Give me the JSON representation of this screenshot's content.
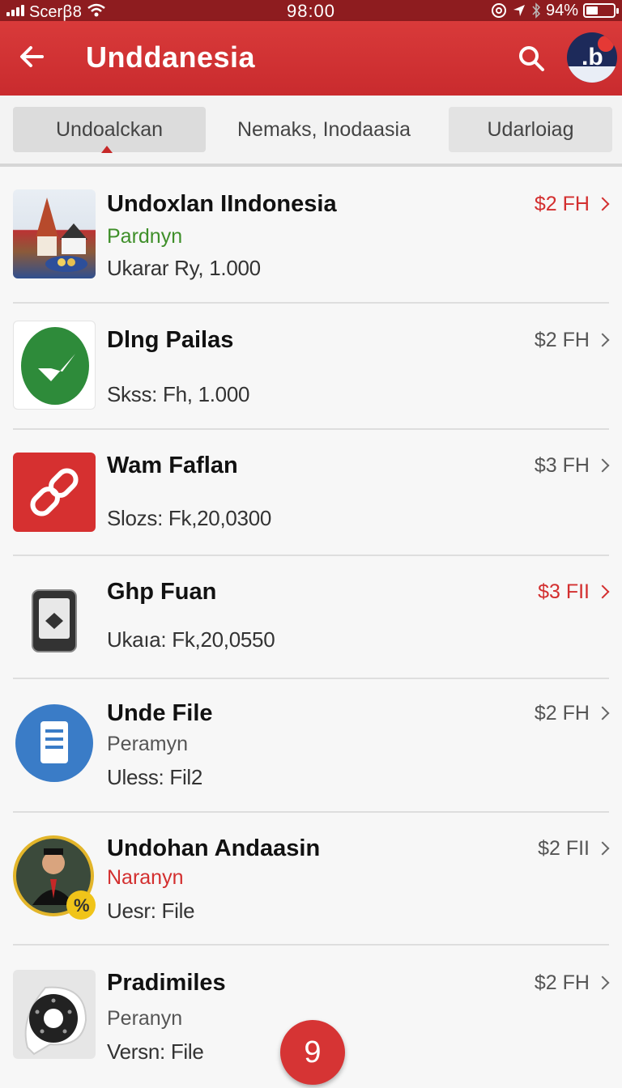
{
  "status_bar": {
    "carrier": "Scerꞵ8",
    "time": "98:00",
    "battery": "94%"
  },
  "app_bar": {
    "title": "Unddanesia",
    "avatar_letter": ".b"
  },
  "tabs": [
    {
      "label": "Undoalckan",
      "active": true
    },
    {
      "label": "Nemaks, Inodaasia",
      "active": false
    },
    {
      "label": "Udarloiag",
      "active": false
    }
  ],
  "items": [
    {
      "title": "Undoxlan IIndonesia",
      "subtitle": "Pardnyn",
      "subtitle_color": "#3f8f2a",
      "meta": "Ukarar Ry, 1.000",
      "price": "$2 FH",
      "price_red": true,
      "icon": "indonesia-landmarks-icon"
    },
    {
      "title": "Dlng Pailas",
      "subtitle": "",
      "subtitle_color": "#555555",
      "meta": "Skss: Fh, 1.000",
      "price": "$2 FH",
      "price_red": false,
      "icon": "green-check-icon"
    },
    {
      "title": "Wam Faflan",
      "subtitle": "",
      "subtitle_color": "#555555",
      "meta": "Slozs: Fk,20,0300",
      "price": "$3 FH",
      "price_red": false,
      "icon": "link-icon"
    },
    {
      "title": "Ghp Fuan",
      "subtitle": "",
      "subtitle_color": "#555555",
      "meta": "Ukaıa: Fk,20,0550",
      "price": "$3 FII",
      "price_red": true,
      "icon": "phone-icon"
    },
    {
      "title": "Unde File",
      "subtitle": "Peramyn",
      "subtitle_color": "#555555",
      "meta": "Uless: Fil2",
      "price": "$2 FH",
      "price_red": false,
      "icon": "document-icon"
    },
    {
      "title": "Undohan Andaasin",
      "subtitle": "Naranyn",
      "subtitle_color": "#d32f2f",
      "meta": "Uesr: File",
      "price": "$2 FII",
      "price_red": false,
      "icon": "person-portrait-icon"
    },
    {
      "title": "Pradimiles",
      "subtitle": "Peranyn",
      "subtitle_color": "#555555",
      "meta": "Versn: File",
      "price": "$2 FH",
      "price_red": false,
      "icon": "dial-icon"
    }
  ],
  "fab": {
    "label": "9"
  },
  "colors": {
    "primary": "#d32f2f",
    "status_bar": "#8e1c1f"
  }
}
